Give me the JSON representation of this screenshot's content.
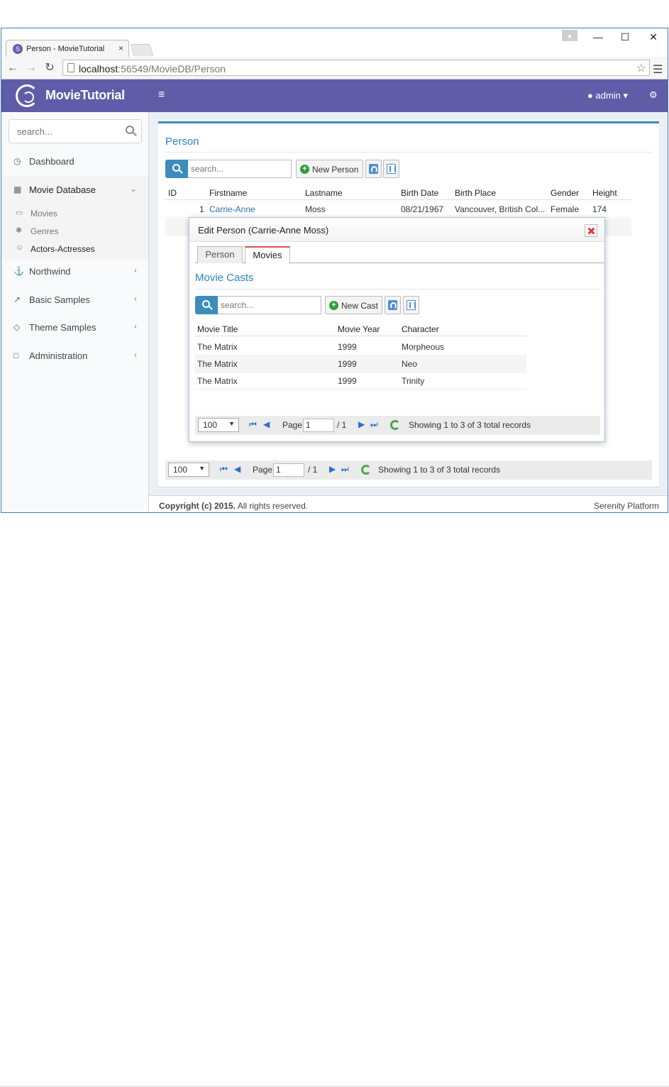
{
  "browser": {
    "tab_title": "Person - MovieTutorial",
    "tab_close": "×",
    "url_host": "localhost",
    "url_rest": ":56549/MovieDB/Person",
    "window_minimize": "—",
    "window_maximize": "☐",
    "window_close": "✕"
  },
  "header": {
    "app_name": "MovieTutorial",
    "user": "admin"
  },
  "sidebar": {
    "search_placeholder": "search...",
    "items": [
      {
        "label": "Dashboard"
      },
      {
        "label": "Movie Database"
      },
      {
        "label": "Northwind"
      },
      {
        "label": "Basic Samples"
      },
      {
        "label": "Theme Samples"
      },
      {
        "label": "Administration"
      }
    ],
    "submenu": [
      {
        "label": "Movies"
      },
      {
        "label": "Genres"
      },
      {
        "label": "Actors-Actresses"
      }
    ]
  },
  "main": {
    "title": "Person",
    "search_placeholder": "search...",
    "new_button": "New Person",
    "columns": [
      "ID",
      "Firstname",
      "Lastname",
      "Birth Date",
      "Birth Place",
      "Gender",
      "Height"
    ],
    "rows": [
      {
        "id": "1",
        "firstname": "Carrie-Anne",
        "lastname": "Moss",
        "birth_date": "08/21/1967",
        "birth_place": "Vancouver, British Col...",
        "gender": "Female",
        "height": "174"
      }
    ],
    "pager": {
      "page_size": "100",
      "page_label": "Page",
      "page": "1",
      "of_pages": "/ 1",
      "info": "Showing 1 to 3 of 3 total records"
    }
  },
  "dialog": {
    "title": "Edit Person (Carrie-Anne Moss)",
    "tabs": [
      {
        "label": "Person"
      },
      {
        "label": "Movies"
      }
    ],
    "active_tab": "Movies",
    "section_title": "Movie Casts",
    "search_placeholder": "search...",
    "new_button": "New Cast",
    "columns": [
      "Movie Title",
      "Movie Year",
      "Character"
    ],
    "rows": [
      {
        "title": "The Matrix",
        "year": "1999",
        "character": "Morpheous"
      },
      {
        "title": "The Matrix",
        "year": "1999",
        "character": "Neo"
      },
      {
        "title": "The Matrix",
        "year": "1999",
        "character": "Trinity"
      }
    ],
    "pager": {
      "page_size": "100",
      "page_label": "Page",
      "page": "1",
      "of_pages": "/ 1",
      "info": "Showing 1 to 3 of 3 total records"
    }
  },
  "footer": {
    "copyright_bold": "Copyright (c) 2015.",
    "copyright_rest": " All rights reserved.",
    "brand": "Serenity Platform"
  },
  "colors": {
    "header_bg": "#605ca8",
    "accent": "#3c8dbc",
    "title_text": "#2a84c4",
    "active_tab_border": "#d9534f",
    "add_icon": "#2e9e3d"
  },
  "icons": {
    "dashboard": "dashboard-icon",
    "movie_database": "film-icon",
    "movies": "video-icon",
    "genres": "magic-icon",
    "actors": "user-icon",
    "northwind": "anchor-icon",
    "basic_samples": "wand-icon",
    "theme_samples": "diamond-icon",
    "administration": "monitor-icon"
  }
}
